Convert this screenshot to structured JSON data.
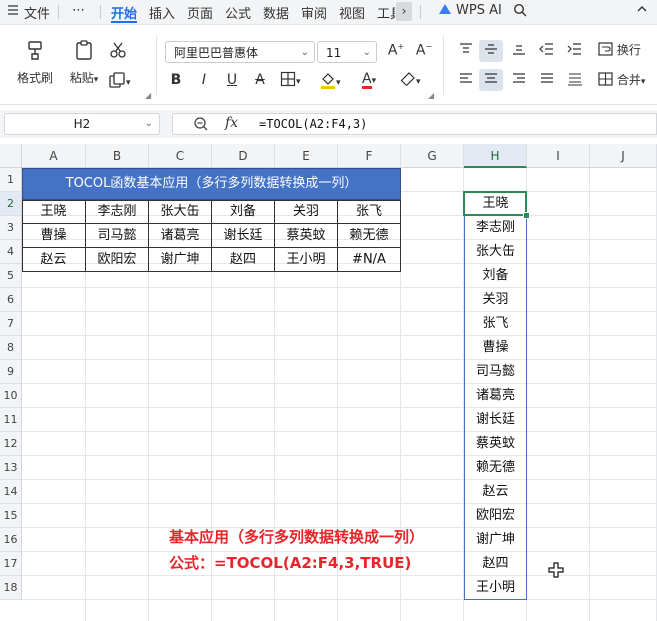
{
  "menu": {
    "items": [
      "文件",
      "⋯",
      "开始",
      "插入",
      "页面",
      "公式",
      "数据",
      "审阅",
      "视图",
      "工具"
    ],
    "active_index": 2,
    "scroll_glyph": "›",
    "wps_ai": "WPS AI"
  },
  "ribbon": {
    "format_painter": "格式刷",
    "paste": "粘贴",
    "font_name": "阿里巴巴普惠体",
    "font_size": "11",
    "wrap": "换行",
    "merge": "合并"
  },
  "formula_bar": {
    "cell_ref": "H2",
    "fx": "fx",
    "formula": "=TOCOL(A2:F4,3)"
  },
  "sheet": {
    "columns": [
      "A",
      "B",
      "C",
      "D",
      "E",
      "F",
      "G",
      "H",
      "I",
      "J"
    ],
    "rows": [
      "1",
      "2",
      "3",
      "4",
      "5",
      "6",
      "7",
      "8",
      "9",
      "10",
      "11",
      "12",
      "13",
      "14",
      "15",
      "16",
      "17",
      "18"
    ],
    "title": "TOCOL函数基本应用（多行多列数据转换成一列）",
    "table": [
      [
        "王晓",
        "李志刚",
        "张大缶",
        "刘备",
        "关羽",
        "张飞"
      ],
      [
        "曹操",
        "司马懿",
        "诸葛亮",
        "谢长廷",
        "蔡英蚊",
        "赖无德"
      ],
      [
        "赵云",
        "欧阳宏",
        "谢广坤",
        "赵四",
        "王小明",
        "#N/A"
      ]
    ],
    "result": [
      "王晓",
      "李志刚",
      "张大缶",
      "刘备",
      "关羽",
      "张飞",
      "曹操",
      "司马懿",
      "诸葛亮",
      "谢长廷",
      "蔡英蚊",
      "赖无德",
      "赵云",
      "欧阳宏",
      "谢广坤",
      "赵四",
      "王小明"
    ]
  },
  "annotation": {
    "line1": "基本应用（多行多列数据转换成一列）",
    "line2": "公式：=TOCOL(A2:F4,3,TRUE)"
  },
  "colors": {
    "accent": "#1f6feb",
    "title_fill": "#4472c4",
    "selection": "#2e8b57",
    "annotation": "#e8262a"
  }
}
